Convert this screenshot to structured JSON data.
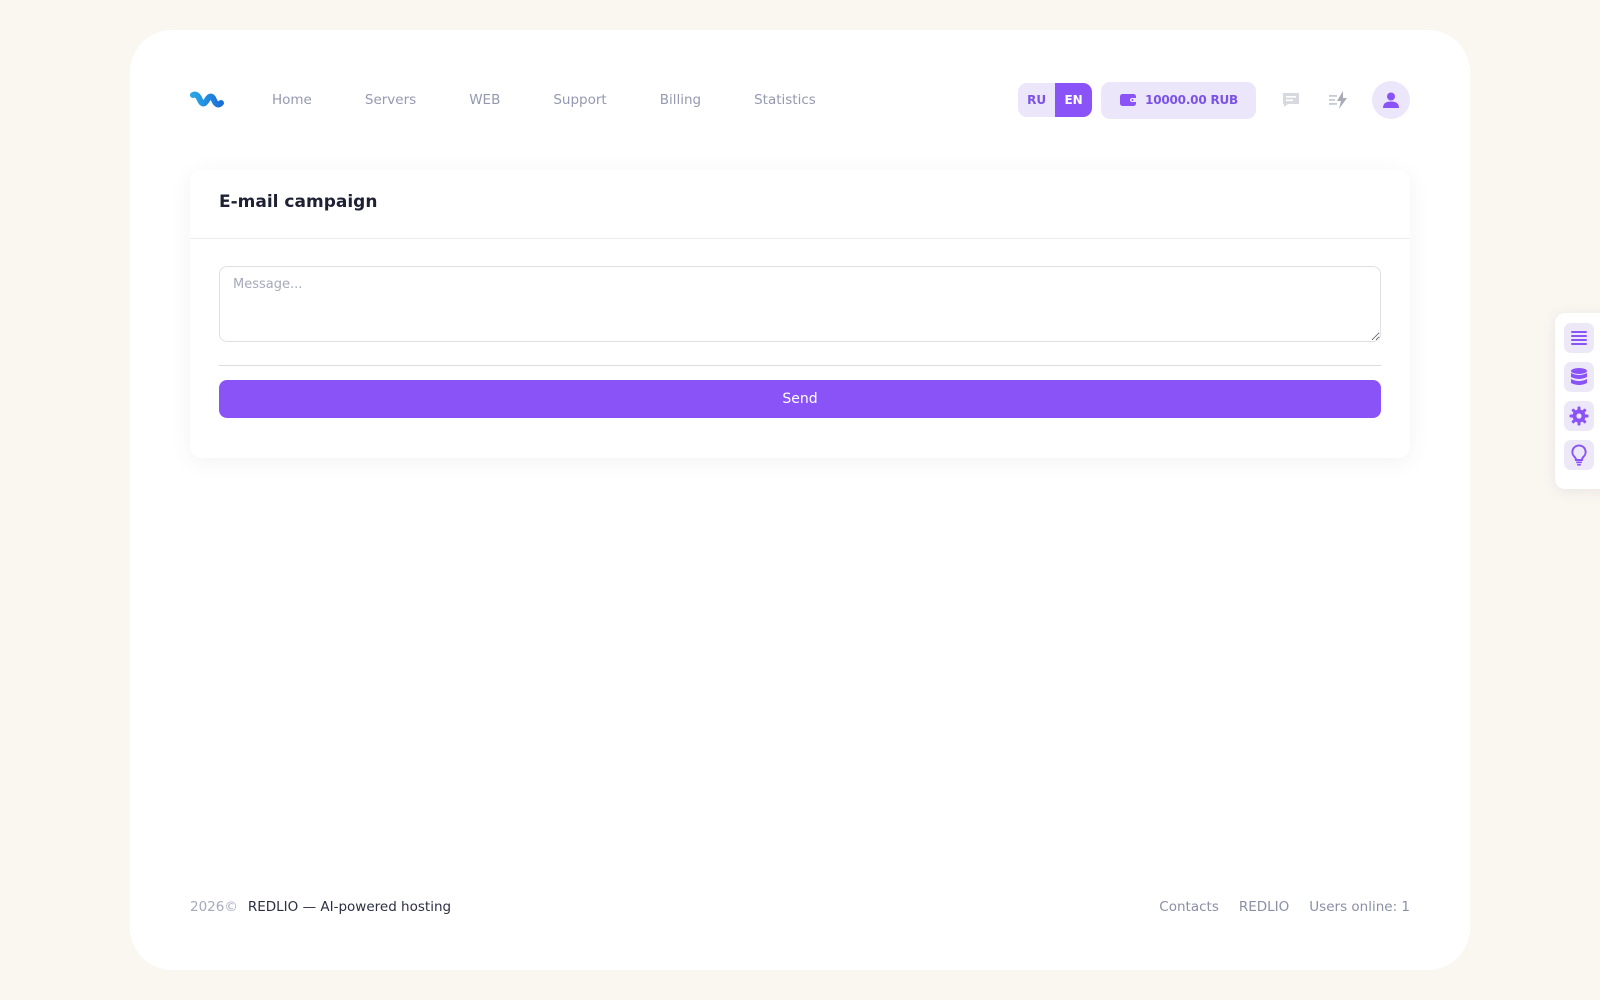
{
  "header": {
    "nav": [
      {
        "label": "Home"
      },
      {
        "label": "Servers"
      },
      {
        "label": "WEB"
      },
      {
        "label": "Support"
      },
      {
        "label": "Billing"
      },
      {
        "label": "Statistics"
      }
    ],
    "lang": {
      "ru": "RU",
      "en": "EN",
      "active": "EN"
    },
    "balance": "10000.00 RUB"
  },
  "main": {
    "title": "E-mail campaign",
    "message_placeholder": "Message...",
    "message_value": "",
    "send_label": "Send"
  },
  "footer": {
    "year": "2026©",
    "brand": "REDLIO — AI-powered hosting",
    "contacts": "Contacts",
    "redlio": "REDLIO",
    "online": "Users online: 1"
  },
  "side_panel": {
    "icons": [
      "list-icon",
      "database-icon",
      "gear-icon",
      "lightbulb-icon"
    ]
  },
  "colors": {
    "accent": "#8a53f8",
    "accent_light": "#ece6fb",
    "background": "#faf6f0",
    "nav_text": "#9599b0"
  }
}
